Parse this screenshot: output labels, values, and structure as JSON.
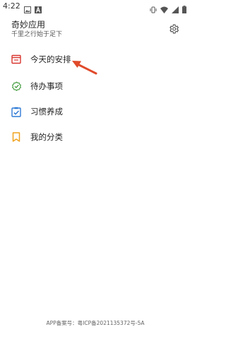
{
  "status_bar": {
    "time": "4:22"
  },
  "header": {
    "title": "奇妙应用",
    "subtitle": "千里之行始于足下"
  },
  "menu": {
    "items": [
      {
        "label": "今天的安排",
        "icon": "calendar-icon",
        "color": "#d9352f"
      },
      {
        "label": "待办事项",
        "icon": "check-badge-icon",
        "color": "#3e9a3a"
      },
      {
        "label": "习惯养成",
        "icon": "clipboard-check-icon",
        "color": "#2f7bd6"
      },
      {
        "label": "我的分类",
        "icon": "bookmark-icon",
        "color": "#f0a21e"
      }
    ]
  },
  "annotation": {
    "arrow_color": "#e04a2a"
  },
  "footer": {
    "icp": "APP备案号：粤ICP备2021135372号-5A"
  }
}
